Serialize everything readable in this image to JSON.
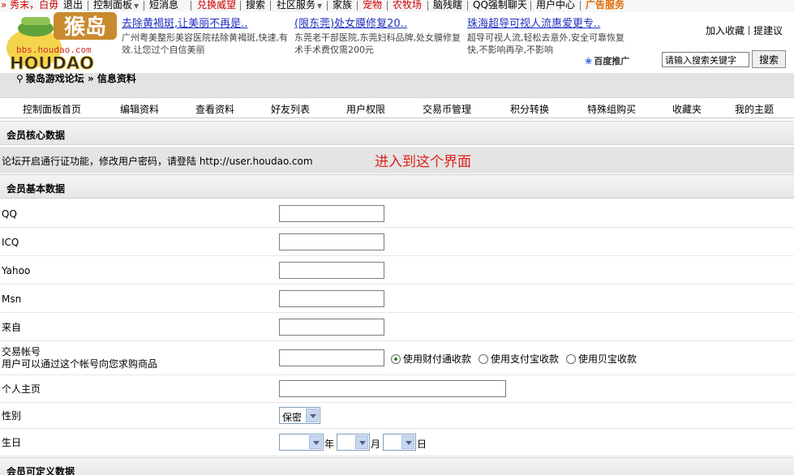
{
  "topnav": {
    "items": [
      {
        "label": "» 秀末，白毋"
      },
      {
        "label": "退出"
      },
      {
        "label": "控制面板"
      },
      {
        "label": "短消息"
      },
      {
        "label": "兑换威望"
      },
      {
        "label": "搜索"
      },
      {
        "label": "社区服务"
      },
      {
        "label": "家族"
      },
      {
        "label": "宠物"
      },
      {
        "label": "农牧场"
      },
      {
        "label": "脑残瞎"
      },
      {
        "label": "QQ强制聊天"
      },
      {
        "label": "用户中心"
      },
      {
        "label": "广告服务"
      }
    ]
  },
  "logo": {
    "text": "猴岛",
    "brand": "HOUDAO",
    "url_text": "bbs.houdao.com"
  },
  "ads": [
    {
      "title": "去除黄褐斑,让美丽不再是..",
      "desc": "广州粤美整形美容医院祛除黄褐斑,快速,有效.让您过个自信美丽"
    },
    {
      "title": "(限东莞)处女膜修复20..",
      "desc": "东莞老干部医院,东莞妇科品牌,处女膜修复术手术费仅需200元"
    },
    {
      "title": "珠海超导可视人流惠爱更专..",
      "desc": "超导可视人流,轻松去意外,安全可靠恢复快,不影响再孕,不影响"
    }
  ],
  "header": {
    "bookmark": "加入收藏",
    "suggest": "提建议",
    "baidu": "百度推广",
    "search_placeholder": "请输入搜索关键字",
    "search_button": "搜索"
  },
  "breadcrumb": {
    "path": "猴岛游戏论坛 » 信息资料"
  },
  "menu": [
    "控制面板首页",
    "编辑资料",
    "查看资料",
    "好友列表",
    "用户权限",
    "交易币管理",
    "积分转换",
    "特殊组购买",
    "收藏夹",
    "我的主题"
  ],
  "sections": {
    "core": "会员核心数据",
    "basic": "会员基本数据",
    "custom": "会员可定义数据"
  },
  "notice": {
    "text": "论坛开启通行证功能，修改用户密码，请登陆 http://user.houdao.com",
    "annotation": "进入到这个界面"
  },
  "form": {
    "qq": "QQ",
    "icq": "ICQ",
    "yahoo": "Yahoo",
    "msn": "Msn",
    "from": "来自",
    "trade_label": "交易帐号",
    "trade_hint": "用户可以通过这个帐号向您求购商品",
    "trade_options": [
      "使用财付通收款",
      "使用支付宝收款",
      "使用贝宝收款"
    ],
    "homepage": "个人主页",
    "gender": "性别",
    "gender_value": "保密",
    "birthday": "生日",
    "year": "年",
    "month": "月",
    "day": "日"
  },
  "colors": {
    "accent_red": "#e0211b",
    "link_blue": "#1f2fc0",
    "menu_orange": "#e06c00"
  }
}
